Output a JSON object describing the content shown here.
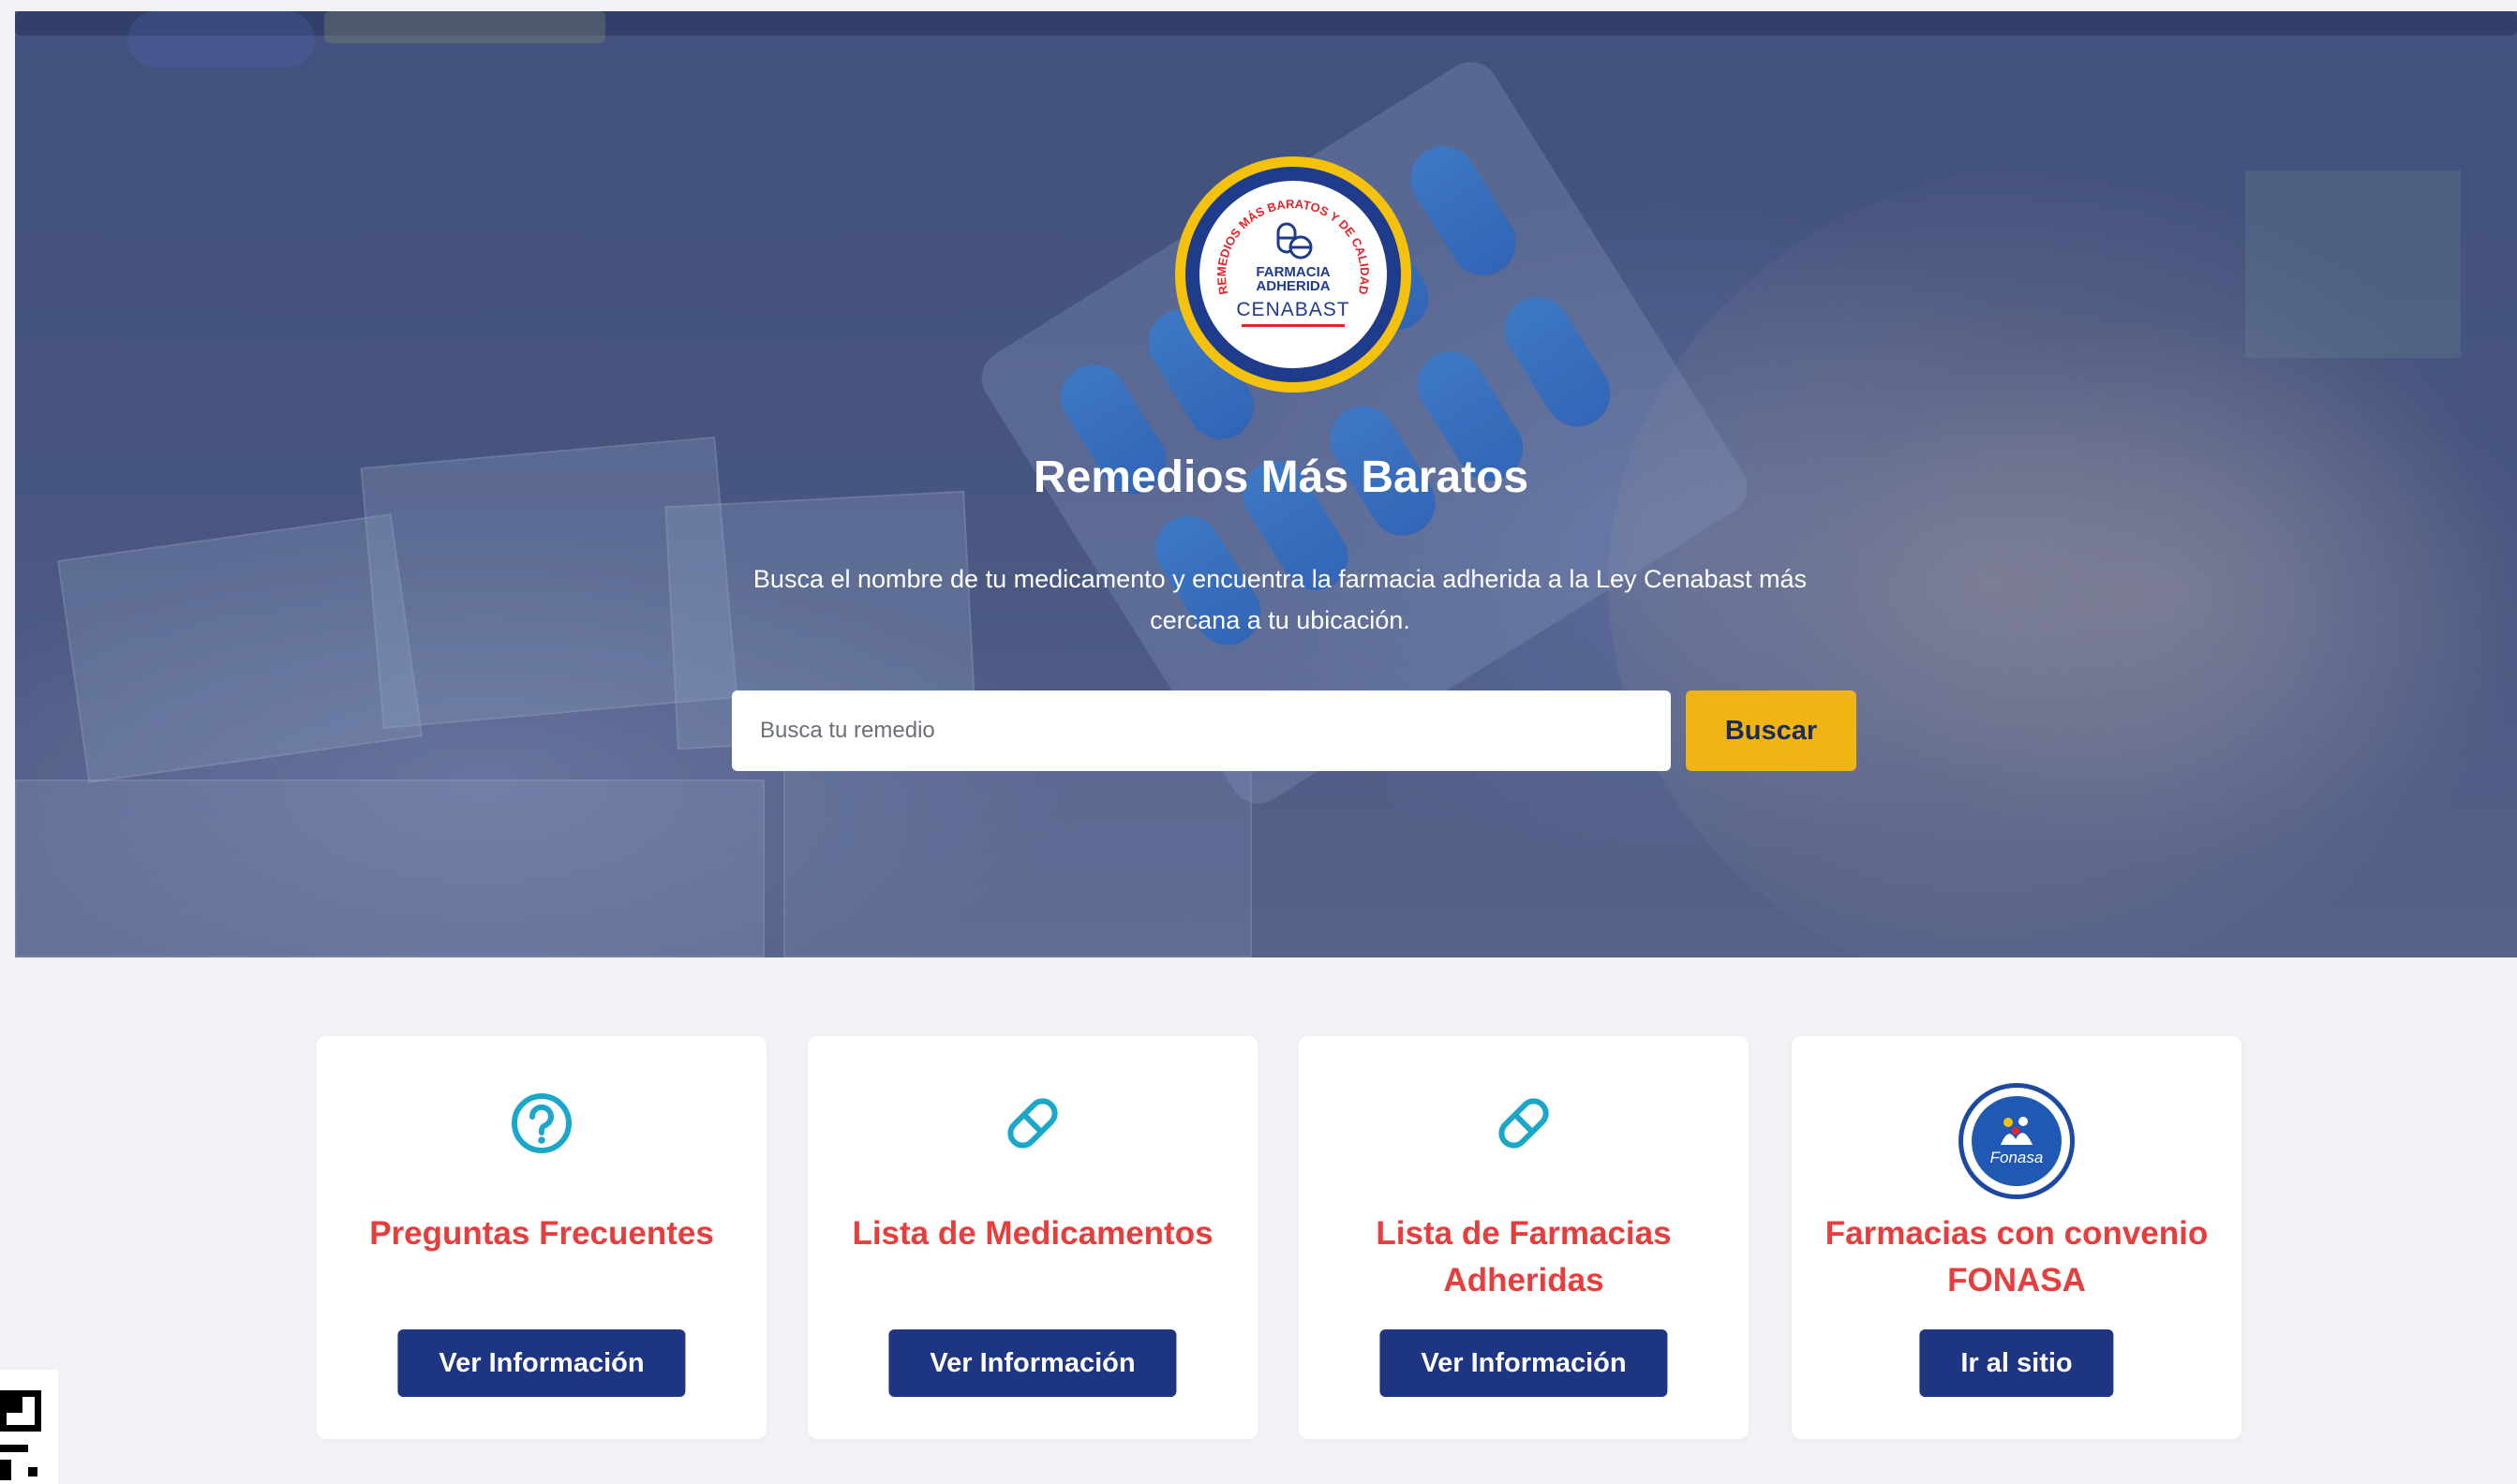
{
  "hero": {
    "logo": {
      "arc_text": "REMEDIOS MÁS BARATOS Y DE CALIDAD",
      "center_text": "FARMACIA ADHERIDA",
      "brand": "CENABAST"
    },
    "title": "Remedios Más Baratos",
    "description": "Busca el nombre de tu medicamento y encuentra la farmacia adherida a la Ley Cenabast más cercana a tu ubicación.",
    "search": {
      "placeholder": "Busca tu remedio",
      "value": "",
      "button_label": "Buscar"
    }
  },
  "cards": [
    {
      "icon": "question-circle-icon",
      "title": "Preguntas Frecuentes",
      "button_label": "Ver Información"
    },
    {
      "icon": "pill-icon",
      "title": "Lista de Medicamentos",
      "button_label": "Ver Información"
    },
    {
      "icon": "pill-icon",
      "title": "Lista de Farmacias Adheridas",
      "button_label": "Ver Información"
    },
    {
      "icon": "fonasa-logo",
      "logo_text": "Fonasa",
      "title": "Farmacias con convenio FONASA",
      "button_label": "Ir al sitio"
    }
  ],
  "colors": {
    "accent_yellow": "#f0b512",
    "brand_navy": "#1e3582",
    "title_red": "#e63d3d",
    "icon_cyan": "#1aa7c9"
  }
}
